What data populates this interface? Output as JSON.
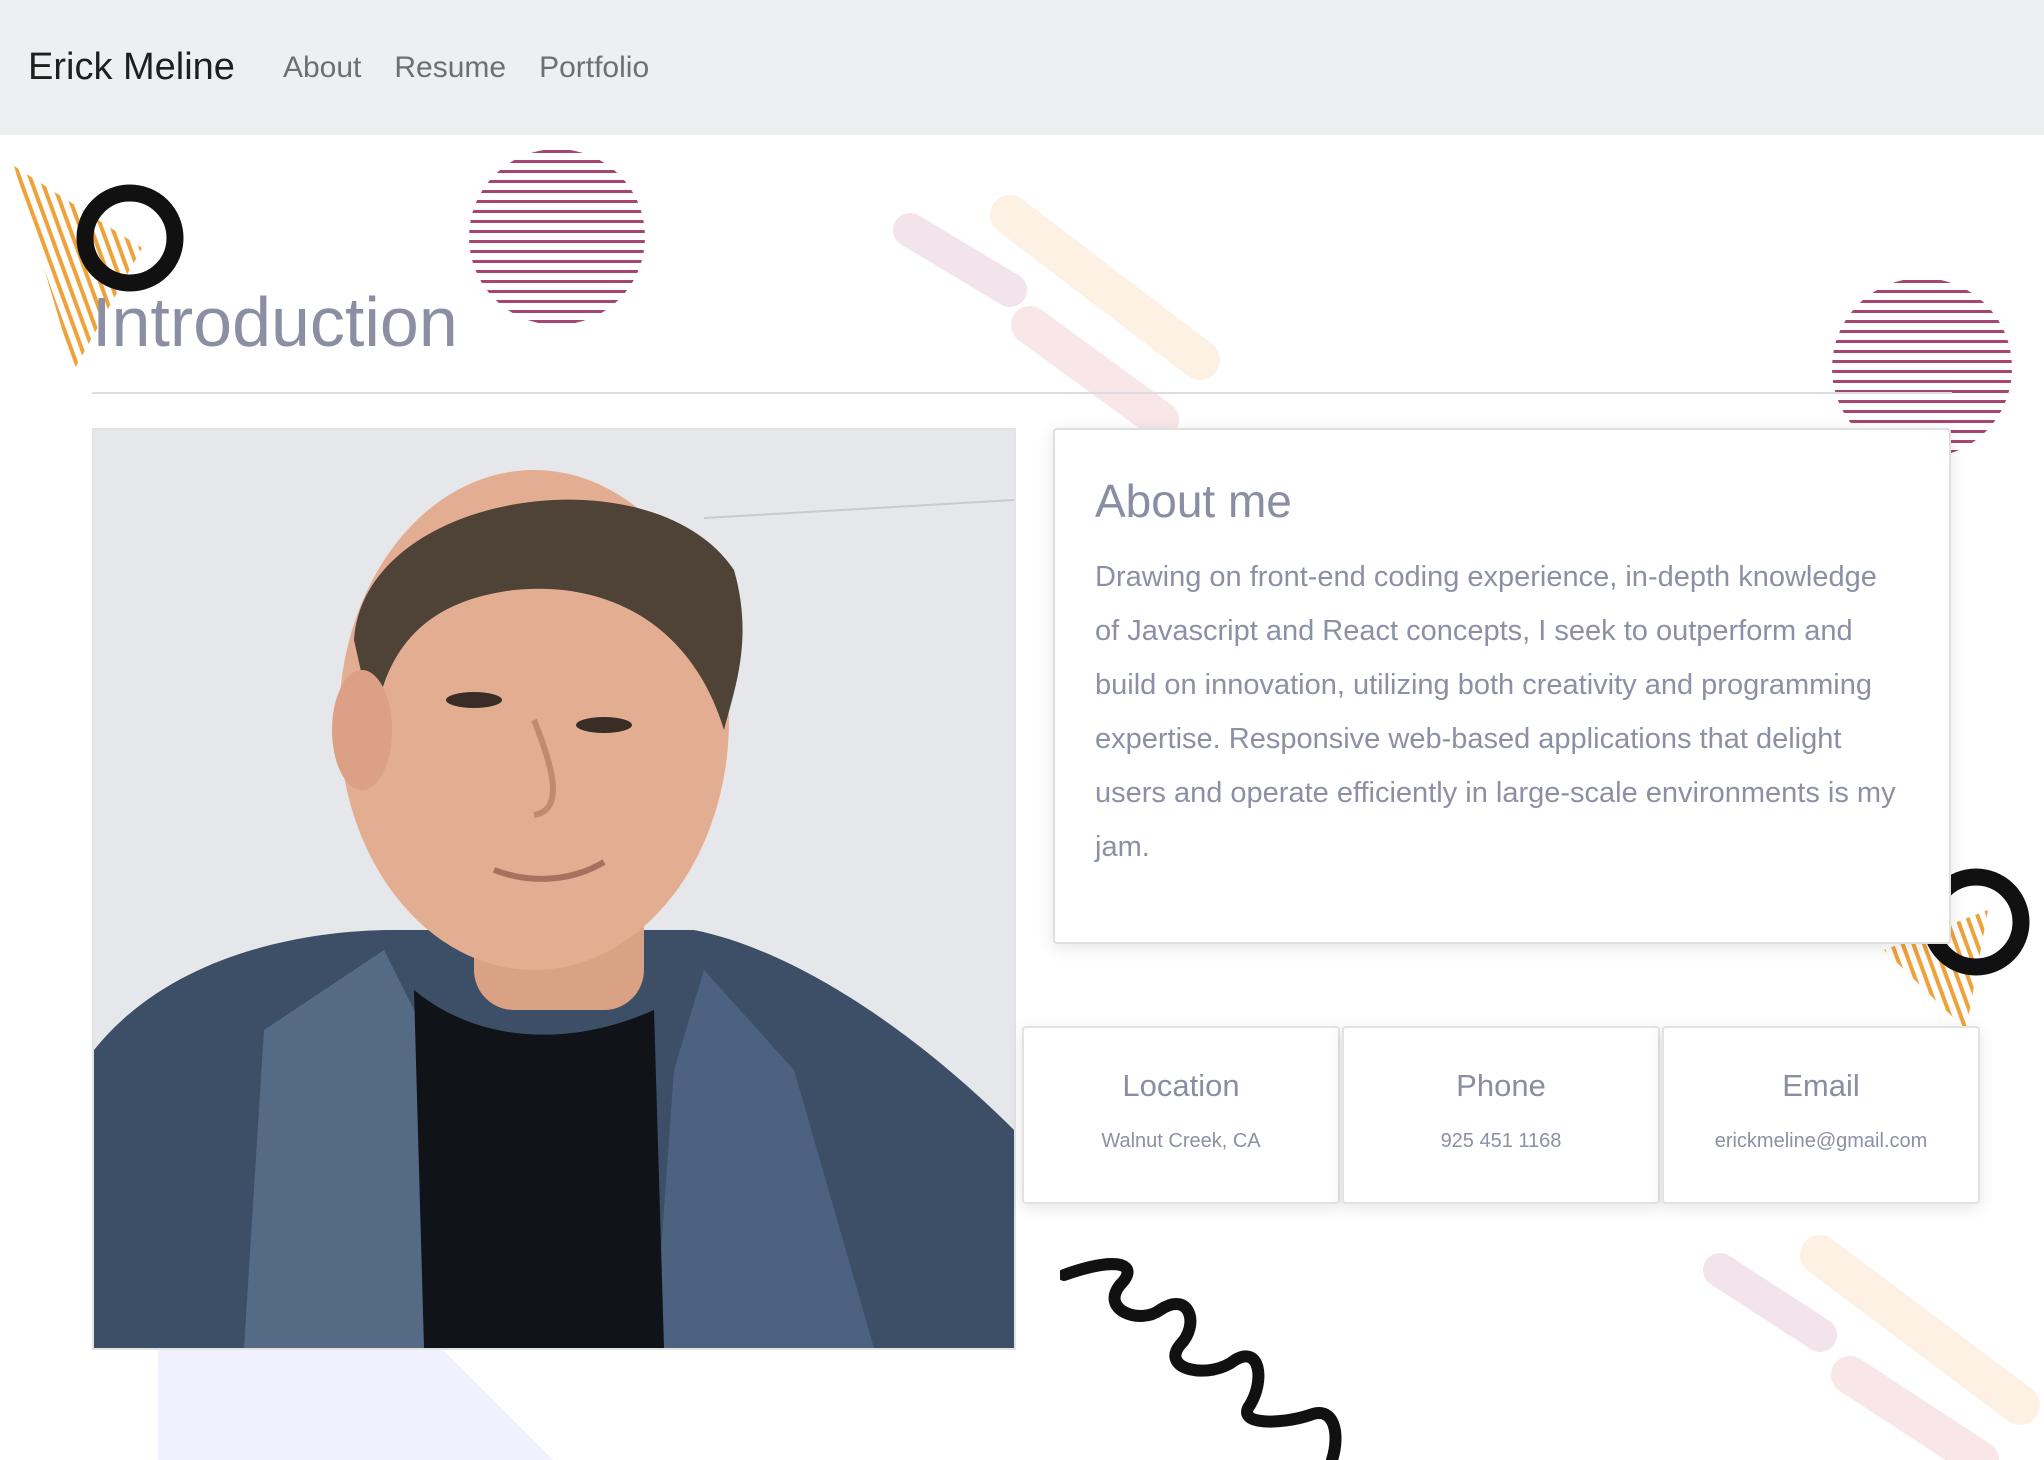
{
  "nav": {
    "brand": "Erick Meline",
    "links": [
      "About",
      "Resume",
      "Portfolio"
    ]
  },
  "intro": {
    "title": "Introduction"
  },
  "photo": {
    "alt": "Erick Meline"
  },
  "about": {
    "title": "About me",
    "text": "Drawing on front-end coding experience, in-depth knowledge of Javascript and React concepts, I seek to outperform and build on innovation, utilizing both creativity and programming expertise. Responsive web-based applications that delight users and operate efficiently in large-scale environments is my jam."
  },
  "contact": [
    {
      "title": "Location",
      "value": "Walnut Creek, CA"
    },
    {
      "title": "Phone",
      "value": "925 451 1168"
    },
    {
      "title": "Email",
      "value": "erickmeline@gmail.com"
    }
  ],
  "colors": {
    "navbar_bg": "#ecf0f1",
    "heading": "#8c8fa3",
    "stripe_magenta": "#a6456f",
    "triangle_orange": "#f0a23a"
  }
}
